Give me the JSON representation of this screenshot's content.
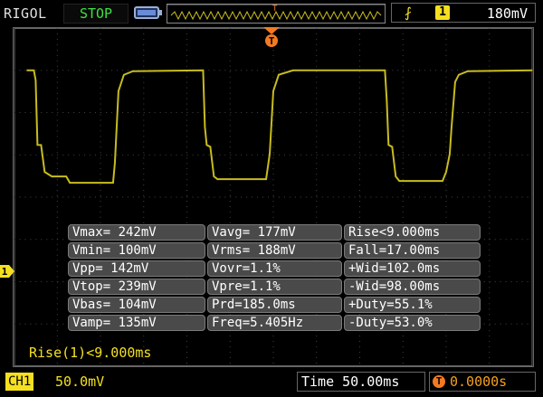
{
  "header": {
    "brand": "RIGOL",
    "run_state": "STOP",
    "trigger": {
      "edge_icon": "rising-edge-icon",
      "source": "1",
      "level": "180mV"
    }
  },
  "waveform": {
    "trigger_marker": "T",
    "channel_marker": "1",
    "color": "#c8bc1e",
    "description_values": {
      "vmax_mV": 242,
      "vmin_mV": 100,
      "period_ms": 185.0
    }
  },
  "measurements": [
    [
      "Vmax= 242mV",
      "Vavg= 177mV",
      "Rise<9.000ms"
    ],
    [
      "Vmin= 100mV",
      "Vrms= 188mV",
      "Fall=17.00ms"
    ],
    [
      "Vpp= 142mV",
      "Vovr=1.1%",
      "+Wid=102.0ms"
    ],
    [
      "Vtop= 239mV",
      "Vpre=1.1%",
      "-Wid=98.00ms"
    ],
    [
      "Vbas= 104mV",
      "Prd=185.0ms",
      "+Duty=55.1%"
    ],
    [
      "Vamp= 135mV",
      "Freq=5.405Hz",
      "-Duty=53.0%"
    ]
  ],
  "rise_readout": "Rise(1)<9.000ms",
  "footer": {
    "channel_label": "CH1",
    "channel_scale": "50.0mV",
    "timebase": "Time 50.00ms",
    "trigger_offset": "0.0000s"
  },
  "colors": {
    "accent_yellow": "#f4e020",
    "stop_green": "#3ee23e",
    "trigger_orange": "#f47a20"
  }
}
